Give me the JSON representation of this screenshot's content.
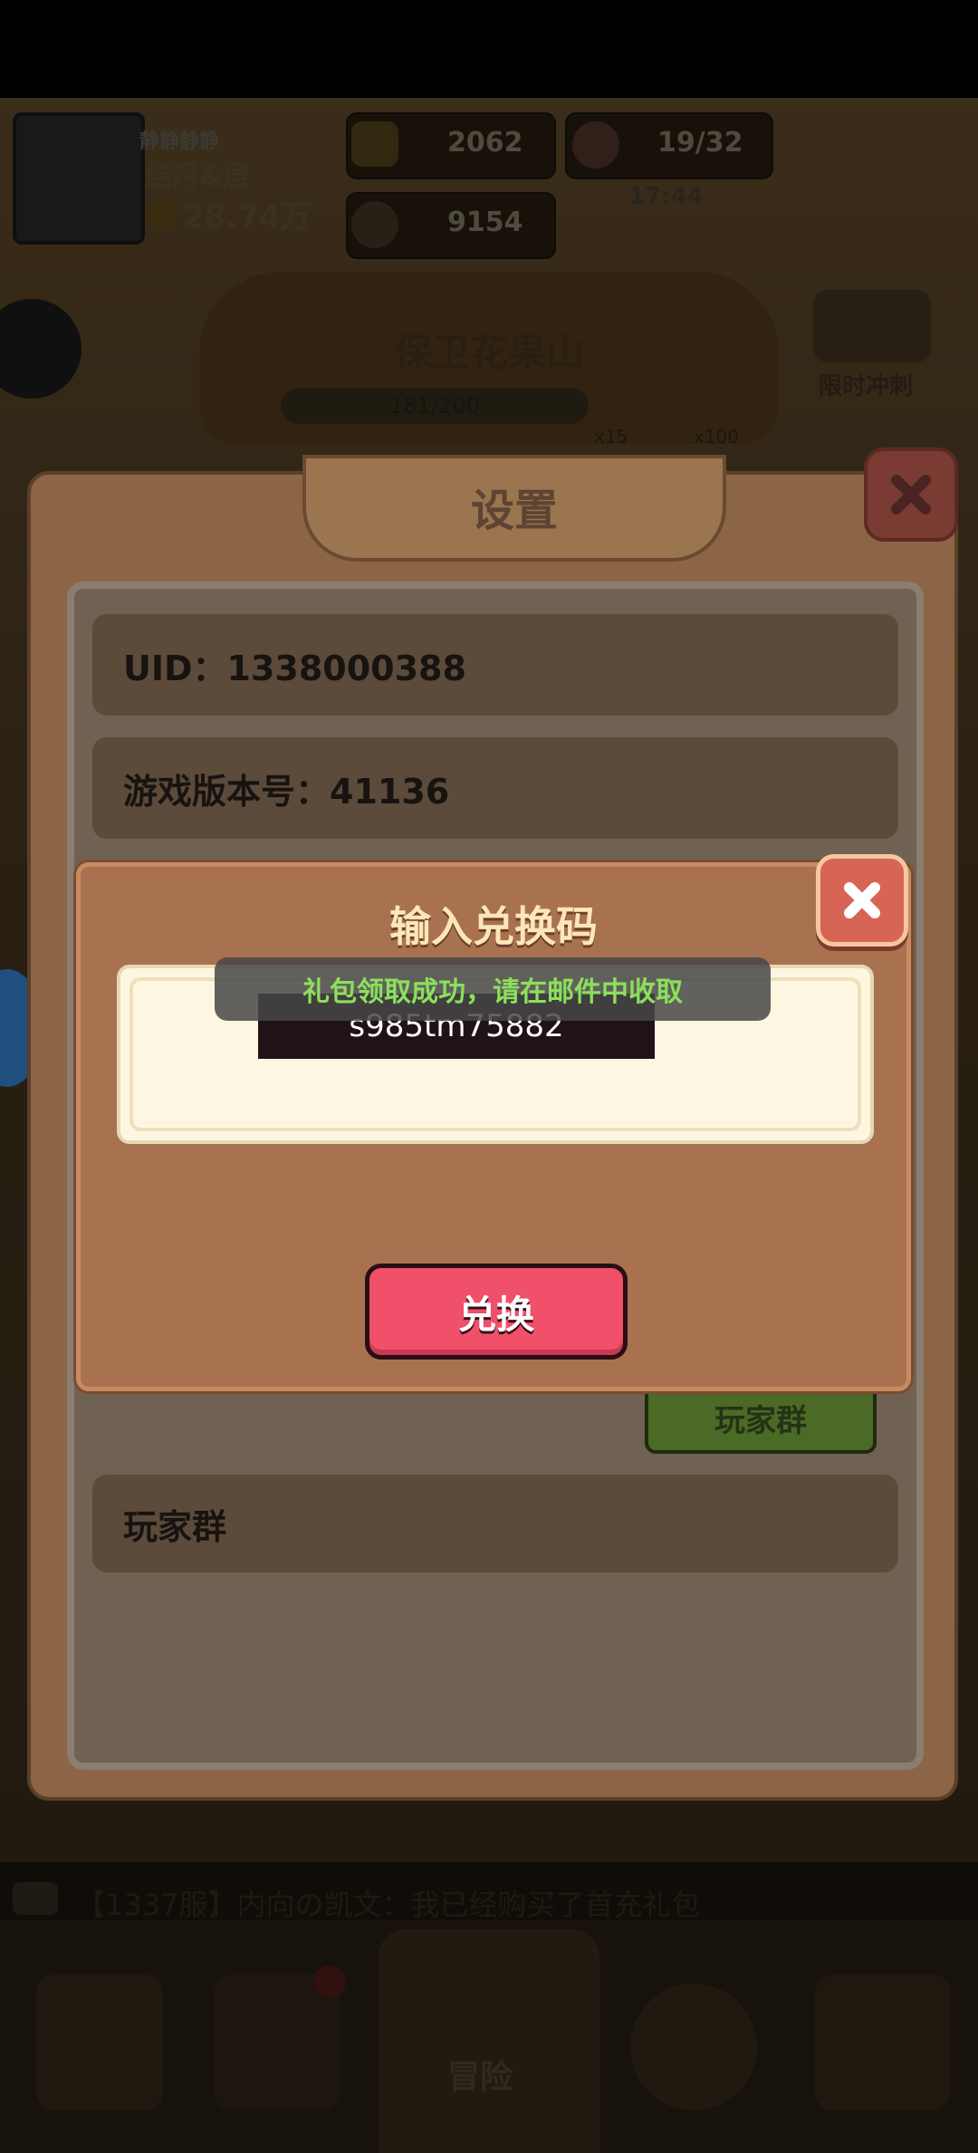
{
  "hud": {
    "player_name": "静静静静",
    "player_title": "结丹&层",
    "power": "28.74万",
    "gold": "2062",
    "gems": "9154",
    "peach": "19/32",
    "timer": "17:44",
    "limited_event": "限时冲刺"
  },
  "stage": {
    "name": "保卫花果山",
    "progress": "181/200",
    "reward1_count": "x15",
    "reward2_count": "x100"
  },
  "settings": {
    "title": "设置",
    "uid_row": "UID：1338000388",
    "version_row": "游戏版本号：41136",
    "group_row_label": "玩家群",
    "group_button": "玩家群"
  },
  "redeem": {
    "title": "输入兑换码",
    "code": "s985tm75882",
    "toast": "礼包领取成功，请在邮件中收取",
    "button": "兑换"
  },
  "chat": {
    "message": "【1337服】内向の凯文：我已经购买了首充礼包"
  },
  "nav": {
    "adventure": "冒险"
  },
  "colors": {
    "accent_red": "#f0506a",
    "toast_green": "#8ce05a",
    "dialog_bg": "#a87251"
  }
}
